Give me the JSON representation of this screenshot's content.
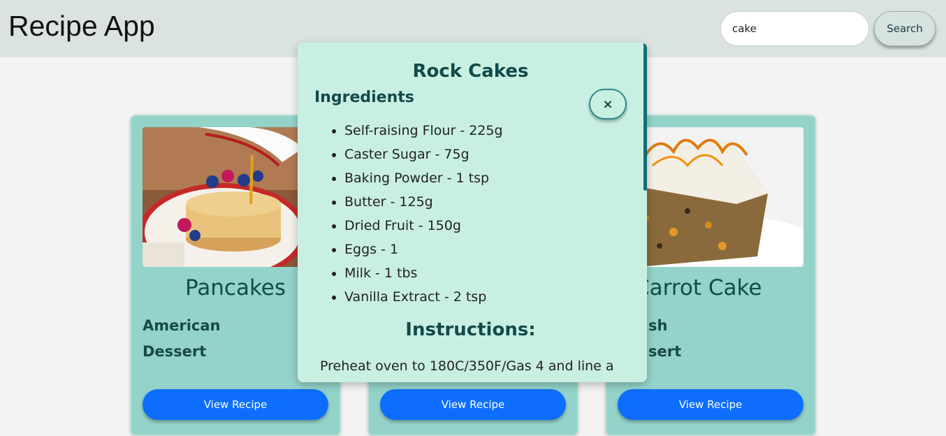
{
  "header": {
    "title": "Recipe App",
    "search_value": "cake",
    "search_placeholder": "",
    "search_button_label": "Search"
  },
  "cards": [
    {
      "title": "Pancakes",
      "area": "American",
      "category": "Dessert",
      "button_label": "View Recipe"
    },
    {
      "title": "",
      "area": "",
      "category": "",
      "button_label": "View Recipe"
    },
    {
      "title": "Carrot Cake",
      "area": "sh",
      "category": "sert",
      "button_label": "View Recipe"
    }
  ],
  "modal": {
    "title": "Rock Cakes",
    "ingredients_heading": "Ingredients",
    "close_label": "×",
    "ingredients": [
      "Self-raising Flour - 225g",
      "Caster Sugar - 75g",
      "Baking Powder - 1 tsp",
      "Butter - 125g",
      "Dried Fruit - 150g",
      "Eggs - 1",
      "Milk - 1 tbs",
      "Vanilla Extract - 2 tsp"
    ],
    "instructions_heading": "Instructions:",
    "instructions_text": "Preheat oven to 180C/350F/Gas 4 and line a"
  },
  "colors": {
    "header_bg": "#dae3de",
    "card_bg": "#93d3c9",
    "modal_bg": "#c9efe3",
    "accent": "#0d6efd",
    "heading_text": "#134a4a"
  }
}
